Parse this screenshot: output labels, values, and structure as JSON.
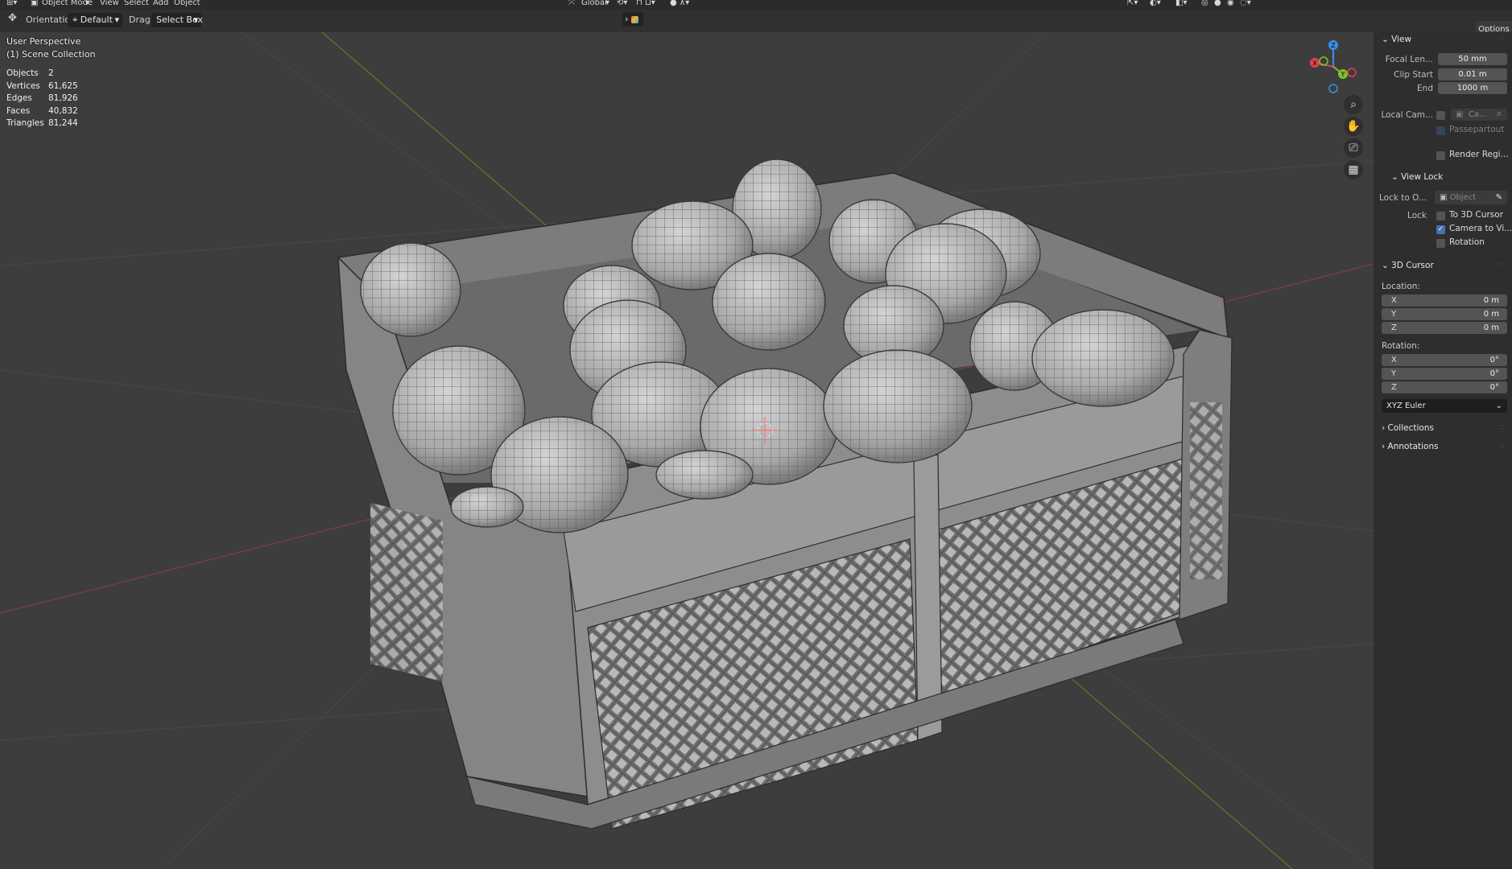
{
  "menu": {
    "mode": "Object Mode",
    "items": [
      "View",
      "Select",
      "Add",
      "Object"
    ],
    "transform_orientation": "Global"
  },
  "toolbar": {
    "orientation_label": "Orientation:",
    "orientation_value": "Default",
    "drag_label": "Drag:",
    "drag_value": "Select Box",
    "options_label": "Options"
  },
  "viewport": {
    "view_name": "User Perspective",
    "collection": "(1) Scene Collection",
    "stats": [
      {
        "label": "Objects",
        "value": "2"
      },
      {
        "label": "Vertices",
        "value": "61,625"
      },
      {
        "label": "Edges",
        "value": "81,926"
      },
      {
        "label": "Faces",
        "value": "40,832"
      },
      {
        "label": "Triangles",
        "value": "81,244"
      }
    ],
    "gizmo_axes": {
      "x": "X",
      "y": "Y",
      "z": "Z"
    }
  },
  "sidebar": {
    "view": {
      "title": "View",
      "focal_label": "Focal Len...",
      "focal_value": "50 mm",
      "clip_start_label": "Clip Start",
      "clip_start_value": "0.01 m",
      "clip_end_label": "End",
      "clip_end_value": "1000 m",
      "local_cam_label": "Local Cam...",
      "local_cam_value": "Ca...",
      "passepartout_label": "Passepartout",
      "render_region_label": "Render Regi..."
    },
    "view_lock": {
      "title": "View Lock",
      "lock_object_label": "Lock to O...",
      "lock_object_placeholder": "Object",
      "lock_label": "Lock",
      "to_cursor_label": "To 3D Cursor",
      "camera_to_view_label": "Camera to Vi...",
      "camera_to_view_checked": true,
      "rotation_label": "Rotation"
    },
    "cursor": {
      "title": "3D Cursor",
      "location_label": "Location:",
      "location": [
        {
          "axis": "X",
          "value": "0 m"
        },
        {
          "axis": "Y",
          "value": "0 m"
        },
        {
          "axis": "Z",
          "value": "0 m"
        }
      ],
      "rotation_label": "Rotation:",
      "rotation": [
        {
          "axis": "X",
          "value": "0°"
        },
        {
          "axis": "Y",
          "value": "0°"
        },
        {
          "axis": "Z",
          "value": "0°"
        }
      ],
      "rotation_mode": "XYZ Euler"
    },
    "collections_title": "Collections",
    "annotations_title": "Annotations"
  },
  "colors": {
    "viewport_bg": "#3d3d3d",
    "panel_bg": "#2e2e2e",
    "field_bg": "#545454",
    "accent_blue": "#4772b3",
    "axis_x": "#e0424f",
    "axis_y": "#7ec22a",
    "axis_z": "#3b8fe6"
  }
}
